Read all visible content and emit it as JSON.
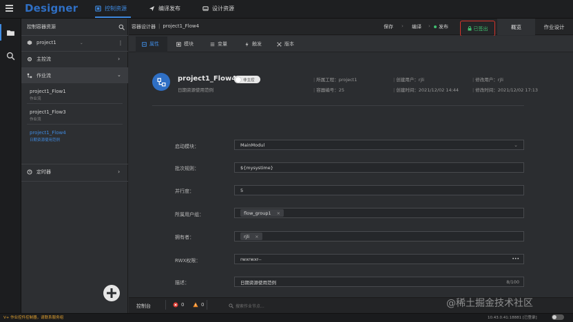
{
  "header": {
    "brand": "Designer",
    "tabs": [
      {
        "label": "控制资源",
        "icon": "control-panel-icon"
      },
      {
        "label": "编译发布",
        "icon": "send-icon"
      },
      {
        "label": "设计资源",
        "icon": "drive-icon"
      }
    ]
  },
  "sidebar": {
    "title": "控制容器资源",
    "project": "project1",
    "main_flow": "主控流",
    "workflow": "作业流",
    "flows": [
      {
        "name": "project1_Flow1",
        "sub": "作业流"
      },
      {
        "name": "project1_Flow3",
        "sub": "作业流"
      },
      {
        "name": "project1_Flow4",
        "sub": "日期资源使用范例"
      }
    ],
    "timer": "定时器"
  },
  "toolbar": {
    "breadcrumb_root": "容器设计器",
    "breadcrumb_sep": "|",
    "breadcrumb_current": "project1_Flow4",
    "save": "保存",
    "edit": "编译",
    "publish": "发布",
    "published": "已签出",
    "overview": "概览",
    "job_design": "作业设计"
  },
  "subtabs": [
    {
      "label": "属性",
      "icon": "properties-icon"
    },
    {
      "label": "模块",
      "icon": "module-icon"
    },
    {
      "label": "变量",
      "icon": "variable-icon"
    },
    {
      "label": "触发",
      "icon": "trigger-icon"
    },
    {
      "label": "版本",
      "icon": "version-icon"
    }
  ],
  "info": {
    "title": "project1_Flow4",
    "subtitle": "日期资源使用范例",
    "toggle": "非主控",
    "project_label": "所属工程：",
    "project_value": "project1",
    "container_no_label": "容器编号：",
    "container_no_value": "25",
    "creator_label": "创建用户：",
    "creator_value": "rjli",
    "created_label": "创建时间：",
    "created_value": "2021/12/02 14:44",
    "modifier_label": "修改用户：",
    "modifier_value": "rjli",
    "modified_label": "修改时间：",
    "modified_value": "2021/12/02 17:13"
  },
  "form": {
    "start_module_label": "启动模块：",
    "start_module_value": "MainModul",
    "batch_label": "批次规则：",
    "batch_value": "${mysystime}",
    "parallel_label": "并行度：",
    "parallel_value": "5",
    "group_label": "所属用户组：",
    "group_chip": "flow_group1",
    "owner_label": "拥有者：",
    "owner_chip": "rjli",
    "rwx_label": "RWX权限：",
    "rwx_value": "rwxrwxr--",
    "rwx_more": "•••",
    "desc_label": "描述：",
    "desc_value": "日期资源使用范例",
    "desc_count": "8/100",
    "chip_close": "×"
  },
  "console": {
    "label": "控制台",
    "errors": "0",
    "warnings": "0",
    "search_placeholder": "搜索作业节点..."
  },
  "statusbar": {
    "left": "V+ 作业控件控制器，请联系服务组",
    "right": "10.43.0.41:18881 [已登录]"
  },
  "watermark": "@稀土掘金技术社区",
  "colors": {
    "accent": "#3f8ae0",
    "alert_red": "#d9342b",
    "success_green": "#3fbf6f",
    "warning_orange": "#f08a24"
  }
}
